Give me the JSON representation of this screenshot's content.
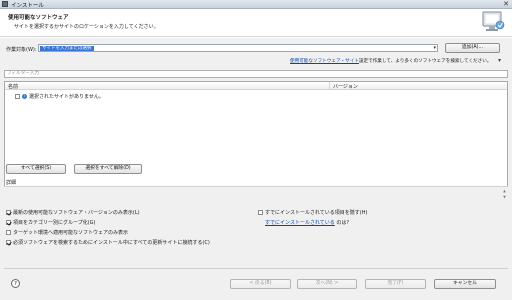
{
  "window": {
    "title": "インストール",
    "close_glyph": "✕"
  },
  "header": {
    "title": "使用可能なソフトウェア",
    "description": "サイトを選択するかサイトのロケーションを入力してください。",
    "graphic_icon": "monitor-install-icon"
  },
  "work_with": {
    "label": "作業対象(W):",
    "value": "サイトを入力または選択",
    "dropdown_icon": "▾",
    "add_button": "追加(A)..."
  },
  "sites_info": {
    "link_text": "使用可能なソフトウェア・サイト",
    "text": "設定で作業して、より多くのソフトウェアを検索してください。",
    "menu_icon": "▾"
  },
  "filter": {
    "placeholder": "フィルター入力"
  },
  "tree": {
    "columns": [
      "名前",
      "バージョン"
    ],
    "rows": [
      {
        "label": "選択されたサイトがありません。",
        "icon": "info-icon"
      }
    ]
  },
  "selection_buttons": {
    "select_all": "すべて選択(S)",
    "deselect_all": "選択をすべて解除(D)"
  },
  "details": {
    "label": "詳細"
  },
  "options": {
    "latest_only": {
      "label": "最新の使用可能なソフトウェア・バージョンのみ表示(L)",
      "checked": true
    },
    "group_by_category": {
      "label": "項目をカテゴリー別にグループ化(G)",
      "checked": true
    },
    "target_env_only": {
      "label": "ターゲット環境へ適用可能なソフトウェアのみ表示",
      "checked": false
    },
    "contact_all_sites": {
      "label": "必須ソフトウェアを検索するためにインストール中にすべての更新サイトに接続する(C)",
      "checked": true
    },
    "hide_installed": {
      "label": "すでにインストールされている項目を隠す(H)",
      "checked": false
    },
    "already_installed_link": "すでにインストールされている",
    "already_installed_suffix": " のは?"
  },
  "footer": {
    "help_glyph": "?",
    "back": "< 戻る(B)",
    "next": "次へ(N) >",
    "finish": "完了(F)",
    "cancel": "キャンセル"
  },
  "colors": {
    "accent": "#3875d7",
    "link": "#0645ad"
  }
}
